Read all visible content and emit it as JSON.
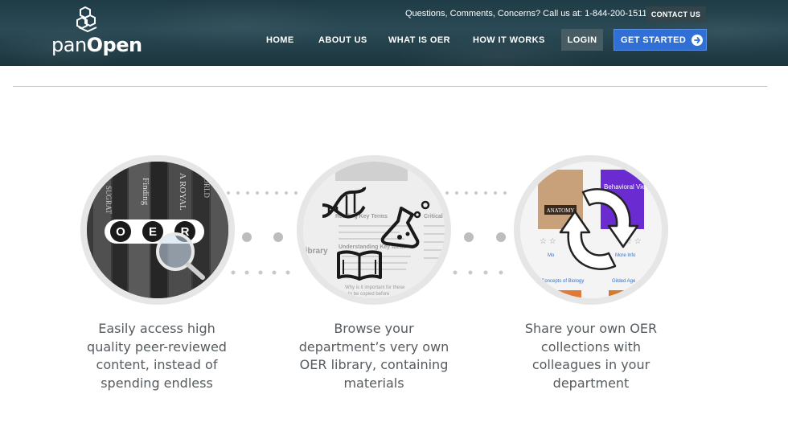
{
  "header": {
    "logo": {
      "text_light": "pan",
      "text_bold": "Open"
    },
    "contact_line": "Questions, Comments, Concerns? Call us at: 1-844-200-1511",
    "contact_button": "CONTACT US",
    "nav": [
      "HOME",
      "ABOUT US",
      "WHAT IS OER",
      "HOW IT WORKS"
    ],
    "login": "LOGIN",
    "get_started": "GET STARTED",
    "colors": {
      "header_bg": "#24414b",
      "cta": "#2f6fd6",
      "login_bg": "#485c63"
    }
  },
  "features": [
    {
      "image": {
        "badge_letters": [
          "O",
          "E",
          "R"
        ],
        "icon": "magnifier-icon",
        "spines": [
          "SUGRAT",
          "Finding",
          "A ROYAL",
          "WORLD"
        ]
      },
      "caption": "Easily access high quality peer-reviewed content, instead of spending endless"
    },
    {
      "image": {
        "icons": [
          "dna-icon",
          "flask-icon",
          "book-icon"
        ],
        "page_text": [
          "Reading Key Terms",
          "Understanding Key Ideas",
          "Critical",
          "library",
          "Why is it important for these",
          "to be copied before"
        ]
      },
      "caption": "Browse your department’s very own OER library, containing materials"
    },
    {
      "image": {
        "icon": "sync-arrows-icon",
        "book_titles": [
          "ANATOMY",
          "Behavioral View of Learning"
        ],
        "collection_labels": [
          "Concepts of Biology",
          "Gilded Age"
        ],
        "links": [
          "Mo",
          "More Info"
        ]
      },
      "caption": "Share your own OER collections with colleagues in your department"
    }
  ]
}
